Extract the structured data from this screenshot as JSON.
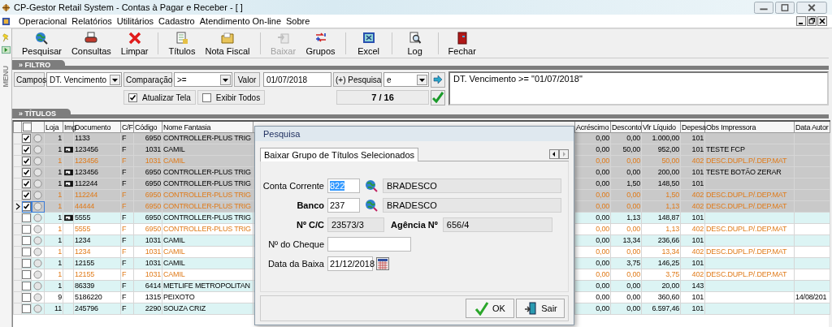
{
  "window": {
    "title": "CP-Gestor Retail System - Contas à Pagar e Receber - [ ]"
  },
  "menu": [
    "Operacional",
    "Relatórios",
    "Utilitários",
    "Cadastro",
    "Atendimento On-line",
    "Sobre"
  ],
  "side_tab": {
    "label": "MENU"
  },
  "toolbar": [
    {
      "label": "Pesquisar",
      "disabled": false,
      "separator_after": false
    },
    {
      "label": "Consultas",
      "disabled": false,
      "separator_after": false
    },
    {
      "label": "Limpar",
      "disabled": false,
      "separator_after": true
    },
    {
      "label": "Títulos",
      "disabled": false,
      "separator_after": false
    },
    {
      "label": "Nota Fiscal",
      "disabled": false,
      "separator_after": true
    },
    {
      "label": "Baixar",
      "disabled": true,
      "separator_after": false
    },
    {
      "label": "Grupos",
      "disabled": false,
      "separator_after": true
    },
    {
      "label": "Excel",
      "disabled": false,
      "separator_after": true
    },
    {
      "label": "Log",
      "disabled": false,
      "separator_after": true
    },
    {
      "label": "Fechar",
      "disabled": false,
      "separator_after": false
    }
  ],
  "filter": {
    "title": "» FILTRO",
    "fields_button": "Campos",
    "field": "DT. Vencimento",
    "comparison_button": "Comparação",
    "comparison": ">=",
    "value_button": "Valor",
    "value": "01/07/2018",
    "more_button": "(+) Pesquisa",
    "connector": "e",
    "refresh": {
      "label": "Atualizar Tela",
      "checked": true
    },
    "show_all": {
      "label": "Exibir Todos",
      "checked": false
    },
    "counter": "7 / 16",
    "expression": "DT. Vencimento >= \"01/07/2018\""
  },
  "titles": {
    "title": "» TÍTULOS",
    "select_all_checked": false,
    "columns": [
      "Loja",
      "Img",
      "Documento",
      "C/F",
      "Código",
      "Nome Fantasia",
      "Acréscimo",
      "Desconto",
      "Vlr Líquido",
      "Depesa",
      "Obs Impressora",
      "Data Autor"
    ],
    "rows": [
      {
        "checked": true,
        "current": false,
        "has_image": false,
        "kind": "title",
        "loja": "1",
        "documento": "1133",
        "cf": "F",
        "codigo": "6950",
        "nome": "CONTROLLER-PLUS TRIG",
        "acrescimo": "0,00",
        "desconto": "0,00",
        "liquido": "1.000,00",
        "depesa": "101"
      },
      {
        "checked": true,
        "current": false,
        "has_image": true,
        "kind": "title",
        "loja": "1",
        "documento": "123456",
        "cf": "F",
        "codigo": "1031",
        "nome": "CAMIL",
        "acrescimo": "0,00",
        "desconto": "50,00",
        "liquido": "952,00",
        "depesa": "101",
        "obs": "TESTE FCP"
      },
      {
        "checked": true,
        "current": false,
        "has_image": false,
        "kind": "deduction",
        "loja": "1",
        "documento": "123456",
        "cf": "F",
        "codigo": "1031",
        "nome": "CAMIL",
        "acrescimo": "0,00",
        "desconto": "0,00",
        "liquido": "50,00",
        "depesa": "402",
        "obs": "DESC.DUPL.P/.DEP.MAT"
      },
      {
        "checked": true,
        "current": false,
        "has_image": true,
        "kind": "title",
        "loja": "1",
        "documento": "123456",
        "cf": "F",
        "codigo": "6950",
        "nome": "CONTROLLER-PLUS TRIG",
        "acrescimo": "0,00",
        "desconto": "0,00",
        "liquido": "200,00",
        "depesa": "101",
        "obs": "TESTE BOTÃO ZERAR"
      },
      {
        "checked": true,
        "current": false,
        "has_image": true,
        "kind": "title",
        "loja": "1",
        "documento": "112244",
        "cf": "F",
        "codigo": "6950",
        "nome": "CONTROLLER-PLUS TRIG",
        "acrescimo": "0,00",
        "desconto": "1,50",
        "liquido": "148,50",
        "depesa": "101"
      },
      {
        "checked": true,
        "current": false,
        "has_image": false,
        "kind": "deduction",
        "loja": "1",
        "documento": "112244",
        "cf": "F",
        "codigo": "6950",
        "nome": "CONTROLLER-PLUS TRIG",
        "acrescimo": "0,00",
        "desconto": "0,00",
        "liquido": "1,50",
        "depesa": "402",
        "obs": "DESC.DUPL.P/.DEP.MAT"
      },
      {
        "checked": true,
        "current": true,
        "has_image": false,
        "kind": "deduction",
        "loja": "1",
        "documento": "44444",
        "cf": "F",
        "codigo": "6950",
        "nome": "CONTROLLER-PLUS TRIG",
        "acrescimo": "0,00",
        "desconto": "0,00",
        "liquido": "1,13",
        "depesa": "402",
        "obs": "DESC.DUPL.P/.DEP.MAT"
      },
      {
        "checked": false,
        "current": false,
        "has_image": true,
        "kind": "title",
        "loja": "1",
        "documento": "5555",
        "cf": "F",
        "codigo": "6950",
        "nome": "CONTROLLER-PLUS TRIG",
        "acrescimo": "0,00",
        "desconto": "1,13",
        "liquido": "148,87",
        "depesa": "101"
      },
      {
        "checked": false,
        "current": false,
        "has_image": false,
        "kind": "deduction",
        "loja": "1",
        "documento": "5555",
        "cf": "F",
        "codigo": "6950",
        "nome": "CONTROLLER-PLUS TRIG",
        "acrescimo": "0,00",
        "desconto": "0,00",
        "liquido": "1,13",
        "depesa": "402",
        "obs": "DESC.DUPL.P/.DEP.MAT"
      },
      {
        "checked": false,
        "current": false,
        "has_image": false,
        "kind": "title",
        "loja": "1",
        "documento": "1234",
        "cf": "F",
        "codigo": "1031",
        "nome": "CAMIL",
        "acrescimo": "0,00",
        "desconto": "13,34",
        "liquido": "236,66",
        "depesa": "101"
      },
      {
        "checked": false,
        "current": false,
        "has_image": false,
        "kind": "deduction",
        "loja": "1",
        "documento": "1234",
        "cf": "F",
        "codigo": "1031",
        "nome": "CAMIL",
        "acrescimo": "0,00",
        "desconto": "0,00",
        "liquido": "13,34",
        "depesa": "402",
        "obs": "DESC.DUPL.P/.DEP.MAT"
      },
      {
        "checked": false,
        "current": false,
        "has_image": false,
        "kind": "title",
        "loja": "1",
        "documento": "12155",
        "cf": "F",
        "codigo": "1031",
        "nome": "CAMIL",
        "acrescimo": "0,00",
        "desconto": "3,75",
        "liquido": "146,25",
        "depesa": "101"
      },
      {
        "checked": false,
        "current": false,
        "has_image": false,
        "kind": "deduction",
        "loja": "1",
        "documento": "12155",
        "cf": "F",
        "codigo": "1031",
        "nome": "CAMIL",
        "acrescimo": "0,00",
        "desconto": "0,00",
        "liquido": "3,75",
        "depesa": "402",
        "obs": "DESC.DUPL.P/.DEP.MAT"
      },
      {
        "checked": false,
        "current": false,
        "has_image": false,
        "kind": "title",
        "loja": "1",
        "documento": "86339",
        "cf": "F",
        "codigo": "6414",
        "nome": "METLIFE METROPOLITAN",
        "acrescimo": "0,00",
        "desconto": "0,00",
        "liquido": "20,00",
        "depesa": "143"
      },
      {
        "checked": false,
        "current": false,
        "has_image": false,
        "kind": "title",
        "loja": "9",
        "documento": "5186220",
        "cf": "F",
        "codigo": "1315",
        "nome": "PEIXOTO",
        "acrescimo": "0,00",
        "desconto": "0,00",
        "liquido": "360,60",
        "depesa": "101",
        "data": "14/08/201"
      },
      {
        "checked": false,
        "current": false,
        "has_image": false,
        "kind": "title",
        "loja": "11",
        "documento": "245796",
        "cf": "F",
        "codigo": "2290",
        "nome": "SOUZA CRIZ",
        "acrescimo": "0,00",
        "desconto": "0,00",
        "liquido": "6.597,46",
        "depesa": "101"
      }
    ]
  },
  "dialog": {
    "title": "Pesquisa",
    "tab": "Baixar Grupo de Títulos Selecionados",
    "conta": {
      "label": "Conta Corrente",
      "value": "822",
      "name": "BRADESCO"
    },
    "banco": {
      "label": "Banco",
      "value": "237",
      "name": "BRADESCO"
    },
    "cc": {
      "label": "Nº C/C",
      "value": "23573/3"
    },
    "agencia": {
      "label": "Agência Nº",
      "value": "656/4"
    },
    "cheque": {
      "label": "Nº do Cheque"
    },
    "data": {
      "label": "Data da Baixa",
      "value": "21/12/2018"
    },
    "buttons": [
      "OK",
      "Sair"
    ]
  }
}
